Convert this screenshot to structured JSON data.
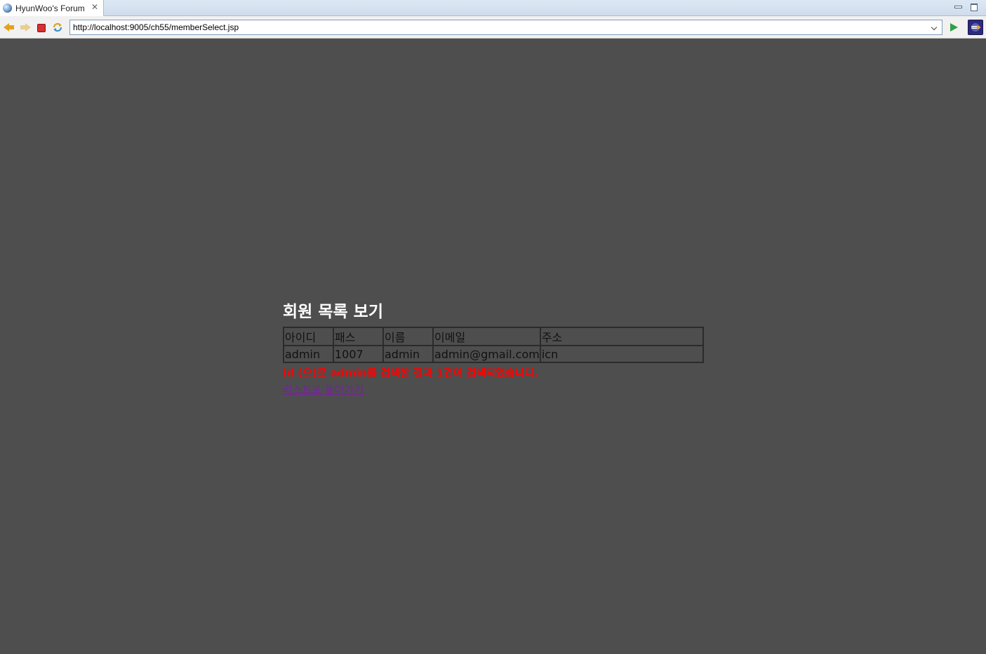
{
  "window": {
    "tab_title": "HyunWoo's Forum",
    "tab_icon": "globe-icon",
    "close_icon": "close-icon"
  },
  "toolbar": {
    "url": "http://localhost:9005/ch55/memberSelect.jsp"
  },
  "page": {
    "title": "회원 목록 보기",
    "table": {
      "headers": [
        "아이디",
        "패스",
        "이름",
        "이메일",
        "주소"
      ],
      "rows": [
        [
          "admin",
          "1007",
          "admin",
          "admin@gmail.com",
          "icn"
        ]
      ]
    },
    "result_message": "id (으)로 admin를 검색한 결과 1건이 검색되었습니다.",
    "back_link": "리스트로 돌아가기"
  },
  "colors": {
    "page_background": "#4e4e4e",
    "title_color": "#ffffff",
    "result_message_color": "#ff0000",
    "link_color": "#7a1fa2"
  }
}
